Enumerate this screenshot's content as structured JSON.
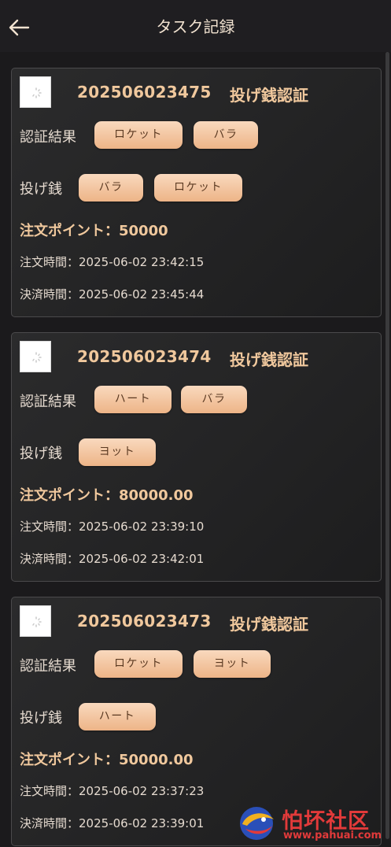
{
  "header": {
    "title": "タスク記録"
  },
  "labels": {
    "result": "認証結果",
    "thrown": "投げ銭",
    "points_prefix": "注文ポイント：",
    "order_time": "注文時間：",
    "settle_time": "決済時間："
  },
  "records": [
    {
      "order_no": "202506023475",
      "type": "投げ銭認証",
      "result": [
        "ロケット",
        "バラ"
      ],
      "thrown": [
        "バラ",
        "ロケット"
      ],
      "points": "50000",
      "order_time": "2025-06-02 23:42:15",
      "settle_time": "2025-06-02 23:45:44"
    },
    {
      "order_no": "202506023474",
      "type": "投げ銭認証",
      "result": [
        "ハート",
        "バラ"
      ],
      "thrown": [
        "ヨット"
      ],
      "points": "80000.00",
      "order_time": "2025-06-02 23:39:10",
      "settle_time": "2025-06-02 23:42:01"
    },
    {
      "order_no": "202506023473",
      "type": "投げ銭認証",
      "result": [
        "ロケット",
        "ヨット"
      ],
      "thrown": [
        "ハート"
      ],
      "points": "50000.00",
      "order_time": "2025-06-02 23:37:23",
      "settle_time": "2025-06-02 23:39:01"
    }
  ],
  "watermark": {
    "text": "怕坏社区",
    "url": "www.pahuai.com"
  }
}
